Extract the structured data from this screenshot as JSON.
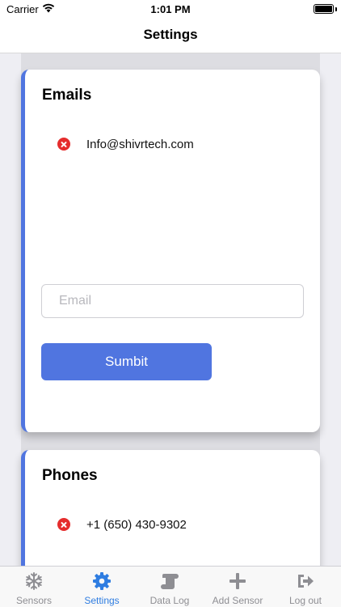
{
  "status_bar": {
    "carrier": "Carrier",
    "time": "1:01 PM"
  },
  "nav": {
    "title": "Settings"
  },
  "emails": {
    "title": "Emails",
    "items": [
      {
        "text": "Info@shivrtech.com"
      }
    ],
    "input_placeholder": "Email",
    "submit_label": "Sumbit"
  },
  "phones": {
    "title": "Phones",
    "items": [
      {
        "text": "+1 (650) 430-9302"
      }
    ]
  },
  "colors": {
    "accent": "#5075e0",
    "remove": "#e52d2d",
    "tab_active": "#2f7de1",
    "tab_inactive": "#8e8e93"
  },
  "tabs": [
    {
      "label": "Sensors",
      "icon": "snowflake-icon",
      "active": false
    },
    {
      "label": "Settings",
      "icon": "gear-icon",
      "active": true
    },
    {
      "label": "Data Log",
      "icon": "scroll-icon",
      "active": false
    },
    {
      "label": "Add Sensor",
      "icon": "plus-icon",
      "active": false
    },
    {
      "label": "Log out",
      "icon": "logout-icon",
      "active": false
    }
  ]
}
